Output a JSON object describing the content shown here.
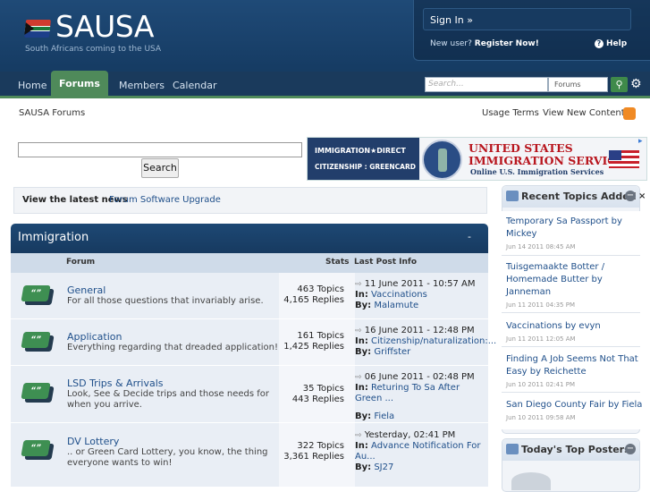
{
  "header": {
    "site_name": "SAUSA",
    "tagline": "South Africans  coming to the USA",
    "sign_in": "Sign In »",
    "new_user_prefix": "New user?",
    "register": "Register Now!",
    "help": "Help"
  },
  "nav": {
    "items": [
      "Home",
      "Forums",
      "Members",
      "Calendar"
    ],
    "active": "Forums",
    "search_placeholder": "Search...",
    "search_scope": "Forums"
  },
  "breadcrumb": "SAUSA Forums",
  "top_links": {
    "usage": "Usage Terms",
    "view_new": "View New Content"
  },
  "search": {
    "button": "Search",
    "value": ""
  },
  "ad": {
    "left_line1": "IMMIGRATION★DIRECT",
    "left_line2": "CITIZENSHIP : GREENCARD",
    "title1": "UNITED STATES",
    "title2": "IMMIGRATION SERVICES",
    "subtitle": "Online U.S. Immigration Services"
  },
  "news": {
    "label": "View the latest news",
    "link": "Forum Software Upgrade"
  },
  "category": {
    "title": "Immigration",
    "collapse": "-"
  },
  "columns": {
    "forum": "Forum",
    "stats": "Stats",
    "last_post": "Last Post Info"
  },
  "forums": [
    {
      "name": "General",
      "desc": "For all those questions that invariably arise.",
      "topics": "463 Topics",
      "replies": "4,165 Replies",
      "date": "11 June 2011 - 10:57 AM",
      "in_label": "In:",
      "in": "Vaccinations",
      "by_label": "By:",
      "by": "Malamute"
    },
    {
      "name": "Application",
      "desc": "Everything regarding that dreaded application!",
      "topics": "161 Topics",
      "replies": "1,425 Replies",
      "date": "16 June 2011 - 12:48 PM",
      "in_label": "In:",
      "in": "Citizenship/naturalization:...",
      "by_label": "By:",
      "by": "Griffster"
    },
    {
      "name": "LSD Trips & Arrivals",
      "desc": "Look, See & Decide trips and those needs for when you arrive.",
      "topics": "35 Topics",
      "replies": "443 Replies",
      "date": "06 June 2011 - 02:48 PM",
      "in_label": "In:",
      "in": "Returing To Sa After Green ...",
      "by_label": "By:",
      "by": "Fiela"
    },
    {
      "name": "DV Lottery",
      "desc": ".. or Green Card Lottery, you know, the thing everyone wants to win!",
      "topics": "322 Topics",
      "replies": "3,361 Replies",
      "date": "Yesterday, 02:41 PM",
      "in_label": "In:",
      "in": "Advance Notification For Au...",
      "by_label": "By:",
      "by": "SJ27"
    }
  ],
  "sidebar": {
    "recent_title": "Recent Topics Added",
    "topics": [
      {
        "line1": "Temporary Sa Passport by",
        "line2": "Mickey",
        "line3": "",
        "date": "Jun 14 2011 08:45 AM"
      },
      {
        "line1": "Tuisgemaakte Botter /",
        "line2": "Homemade Butter by",
        "line3": "Janneman",
        "date": "Jun 11 2011 04:35 PM"
      },
      {
        "line1": "Vaccinations by evyn",
        "line2": "",
        "line3": "",
        "date": "Jun 11 2011 12:05 AM"
      },
      {
        "line1": "Finding A Job Seems Not That",
        "line2": "Easy by Reichette",
        "line3": "",
        "date": "Jun 10 2011 02:41 PM"
      },
      {
        "line1": "San Diego County Fair by Fiela",
        "line2": "",
        "line3": "",
        "date": "Jun 10 2011 09:58 AM"
      }
    ],
    "posters_title": "Today's Top Posters",
    "close": "×",
    "collapse": "−"
  }
}
